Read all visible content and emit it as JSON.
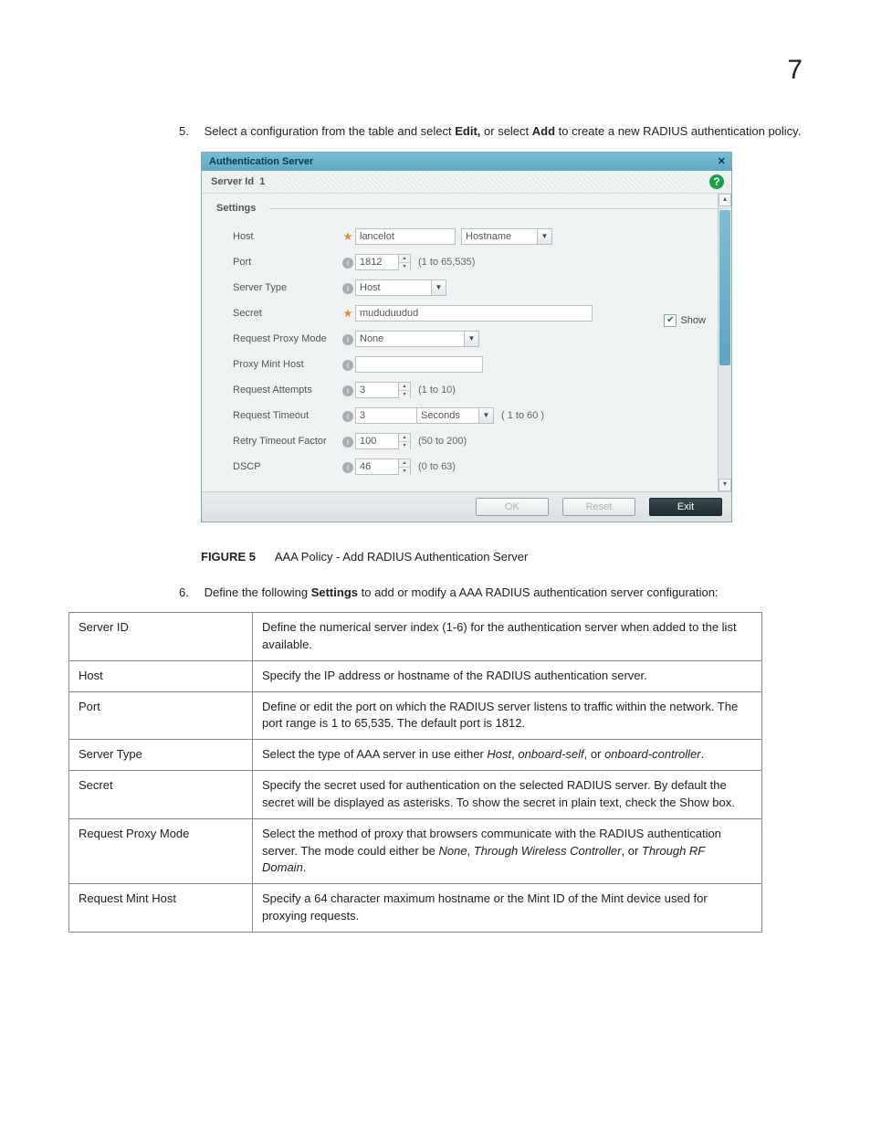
{
  "page_number": "7",
  "step5": {
    "num": "5.",
    "pre": "Select a configuration from the table and select ",
    "edit": "Edit,",
    "mid": " or select ",
    "add": "Add",
    "post": " to create a new RADIUS authentication policy."
  },
  "dialog": {
    "title": "Authentication Server",
    "server_id_label": "Server Id",
    "server_id_value": "1",
    "settings_legend": "Settings",
    "rows": {
      "host": {
        "label": "Host",
        "value": "lancelot",
        "type_sel": "Hostname"
      },
      "port": {
        "label": "Port",
        "value": "1812",
        "hint": "(1 to 65,535)"
      },
      "server_type": {
        "label": "Server Type",
        "value": "Host"
      },
      "secret": {
        "label": "Secret",
        "value": "mududuudud",
        "show_label": "Show"
      },
      "proxy_mode": {
        "label": "Request Proxy Mode",
        "value": "None"
      },
      "mint_host": {
        "label": "Proxy Mint Host",
        "value": ""
      },
      "attempts": {
        "label": "Request Attempts",
        "value": "3",
        "hint": "(1 to 10)"
      },
      "timeout": {
        "label": "Request Timeout",
        "value": "3",
        "unit": "Seconds",
        "hint": "( 1 to 60 )"
      },
      "retry": {
        "label": "Retry Timeout Factor",
        "value": "100",
        "hint": "(50 to 200)"
      },
      "dscp": {
        "label": "DSCP",
        "value": "46",
        "hint": "(0 to 63)"
      }
    },
    "buttons": {
      "ok": "OK",
      "reset": "Reset",
      "exit": "Exit"
    }
  },
  "figure": {
    "num": "FIGURE 5",
    "caption": "AAA Policy - Add RADIUS Authentication Server"
  },
  "step6": {
    "num": "6.",
    "pre": "Define the following ",
    "settings": "Settings",
    "post": " to add or modify a AAA RADIUS authentication server configuration:"
  },
  "table": {
    "r1": {
      "k": "Server ID",
      "v": "Define the numerical server index (1-6) for the authentication server when added to the list available."
    },
    "r2": {
      "k": "Host",
      "v": "Specify the IP address or hostname of the RADIUS authentication server."
    },
    "r3": {
      "k": "Port",
      "v": "Define or edit the port on which the RADIUS server listens to traffic within the network. The port range is 1 to 65,535. The default port is 1812."
    },
    "r4": {
      "k": "Server Type",
      "v_pre": "Select the type of AAA server in use either ",
      "i1": "Host",
      "s1": ", ",
      "i2": "onboard-self",
      "s2": ", or ",
      "i3": "onboard-controller",
      "s3": "."
    },
    "r5": {
      "k": "Secret",
      "v": "Specify the secret used for authentication on the selected RADIUS server. By default the secret will be displayed as asterisks. To show the secret in plain text, check the Show box."
    },
    "r6": {
      "k": "Request Proxy Mode",
      "v_pre": "Select the method of proxy that browsers communicate with the RADIUS authentication server. The mode could either be ",
      "i1": "None",
      "s1": ", ",
      "i2": "Through Wireless Controller",
      "s2": ", or ",
      "i3": "Through RF Domain",
      "s3": "."
    },
    "r7": {
      "k": "Request Mint Host",
      "v": "Specify a 64 character maximum hostname or the Mint ID of the Mint device used for proxying requests."
    }
  }
}
